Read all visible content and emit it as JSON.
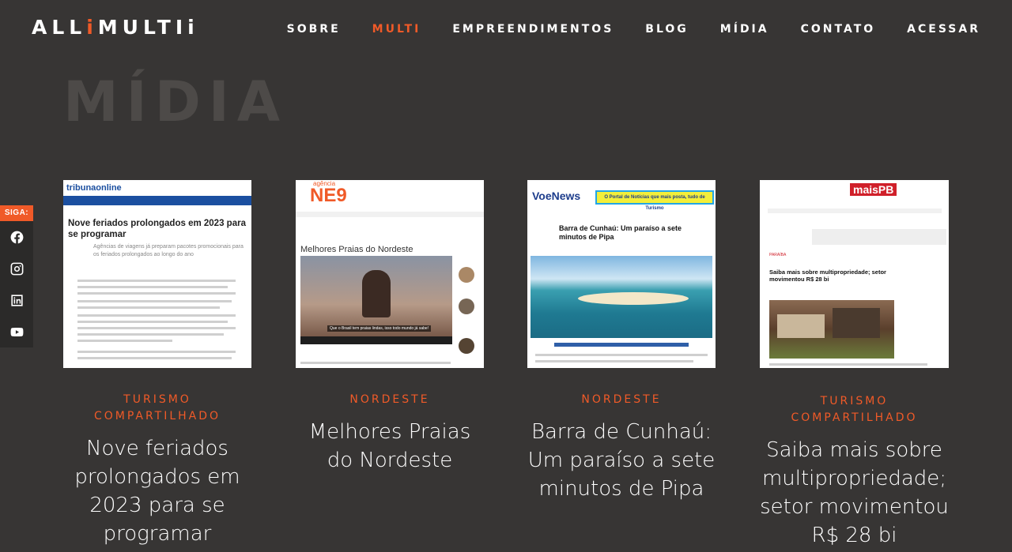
{
  "header": {
    "logo": {
      "part1": "ALL",
      "accent": "i",
      "part2": "MULTI",
      "end": "i"
    },
    "nav": [
      {
        "label": "SOBRE",
        "active": false
      },
      {
        "label": "MULTI",
        "active": true
      },
      {
        "label": "EMPREENDIMENTOS",
        "active": false
      },
      {
        "label": "BLOG",
        "active": false
      },
      {
        "label": "MÍDIA",
        "active": false
      },
      {
        "label": "CONTATO",
        "active": false
      },
      {
        "label": "ACESSAR",
        "active": false
      }
    ]
  },
  "page": {
    "title": "MÍDIA"
  },
  "social": {
    "label": "SIGA:",
    "icons": [
      "facebook-icon",
      "instagram-icon",
      "linkedin-icon",
      "youtube-icon"
    ]
  },
  "cards": [
    {
      "category": "TURISMO COMPARTILHADO",
      "title": "Nove feriados prolongados em 2023 para se programar",
      "thumb": {
        "site": "tribunaonline",
        "headline": "Nove feriados prolongados em 2023 para se programar",
        "sub": "Agências de viagens já preparam pacotes promocionais para os feriados prolongados ao longo do ano"
      }
    },
    {
      "category": "NORDESTE",
      "title": "Melhores Praias do Nordeste",
      "thumb": {
        "site_top": "agência",
        "site": "NE9",
        "headline": "Melhores Praias do Nordeste",
        "caption": "Que o Brasil tem praias lindas, isso todo mundo já sabe!"
      }
    },
    {
      "category": "NORDESTE",
      "title": "Barra de Cunhaú: Um paraíso a sete minutos de Pipa",
      "thumb": {
        "site": "VoeNews",
        "banner": "O Portal de Notícias que mais posta, tudo de Turismo",
        "headline": "Barra de Cunhaú: Um paraíso a sete minutos de Pipa"
      }
    },
    {
      "category": "TURISMO COMPARTILHADO",
      "title": "Saiba mais sobre multipropriedade; setor movimentou R$ 28 bi",
      "thumb": {
        "site": "maisPB",
        "section": "PARAÍBA",
        "headline": "Saiba mais sobre multipropriedade; setor movimentou R$ 28 bi"
      }
    }
  ],
  "colors": {
    "accent": "#f05a28",
    "background": "#373534",
    "title_shadow": "#4d4a48"
  }
}
